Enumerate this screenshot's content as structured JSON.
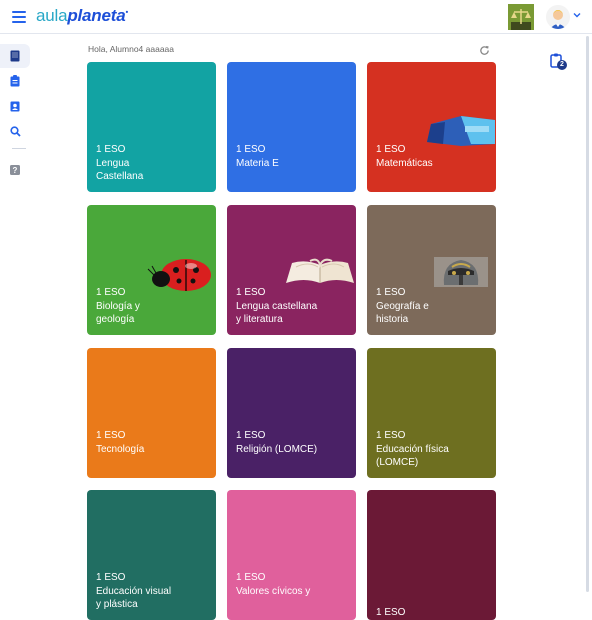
{
  "header": {
    "logo_light": "aula",
    "logo_bold": "planeta",
    "logo_mark": "•"
  },
  "sidebar": {
    "items": [
      {
        "name": "book-icon",
        "active": true
      },
      {
        "name": "clipboard-icon",
        "active": false
      },
      {
        "name": "contact-card-icon",
        "active": false
      },
      {
        "name": "search-icon",
        "active": false
      },
      {
        "name": "help-icon",
        "active": false
      }
    ]
  },
  "greeting": "Hola, Alumno4 aaaaaa",
  "tasks": {
    "badge": "2"
  },
  "cards": [
    {
      "level": "1 ESO",
      "subject": "Lengua Castellana",
      "subject_lines": [
        "Lengua",
        "Castellana"
      ],
      "color": "#12a3a3",
      "decor": ""
    },
    {
      "level": "1 ESO",
      "subject": "Materia E",
      "subject_lines": [
        "Materia E"
      ],
      "color": "#2f6fe4",
      "decor": ""
    },
    {
      "level": "1 ESO",
      "subject": "Matemáticas",
      "subject_lines": [
        "Matemáticas"
      ],
      "color": "#d53121",
      "decor": "blue-object-image"
    },
    {
      "level": "1 ESO",
      "subject": "Biología y geología",
      "subject_lines": [
        "Biología y",
        "geología"
      ],
      "color": "#4aa83a",
      "decor": "ladybug-image"
    },
    {
      "level": "1 ESO",
      "subject": "Lengua castellana y literatura",
      "subject_lines": [
        "Lengua castellana",
        "y literatura"
      ],
      "color": "#8a2460",
      "decor": "open-book-image"
    },
    {
      "level": "1 ESO",
      "subject": "Geografía e historia",
      "subject_lines": [
        "Geografía e",
        "historia"
      ],
      "color": "#7d6a5a",
      "decor": "helmet-image"
    },
    {
      "level": "1 ESO",
      "subject": "Tecnología",
      "subject_lines": [
        "Tecnología"
      ],
      "color": "#ea7a1a",
      "decor": ""
    },
    {
      "level": "1 ESO",
      "subject": "Religión (LOMCE)",
      "subject_lines": [
        "Religión (LOMCE)"
      ],
      "color": "#4a2166",
      "decor": ""
    },
    {
      "level": "1 ESO",
      "subject": "Educación física (LOMCE)",
      "subject_lines": [
        "Educación física",
        "(LOMCE)"
      ],
      "color": "#6e6f20",
      "decor": ""
    },
    {
      "level": "1 ESO",
      "subject": "Educación visual y plástica",
      "subject_lines": [
        "Educación visual",
        "y plástica"
      ],
      "color": "#216e62",
      "decor": ""
    },
    {
      "level": "1 ESO",
      "subject": "Valores cívicos y",
      "subject_lines": [
        "Valores cívicos y"
      ],
      "color": "#e0609c",
      "decor": ""
    },
    {
      "level": "1 ESO",
      "subject": "",
      "subject_lines": [],
      "color": "#6b1936",
      "decor": ""
    }
  ]
}
